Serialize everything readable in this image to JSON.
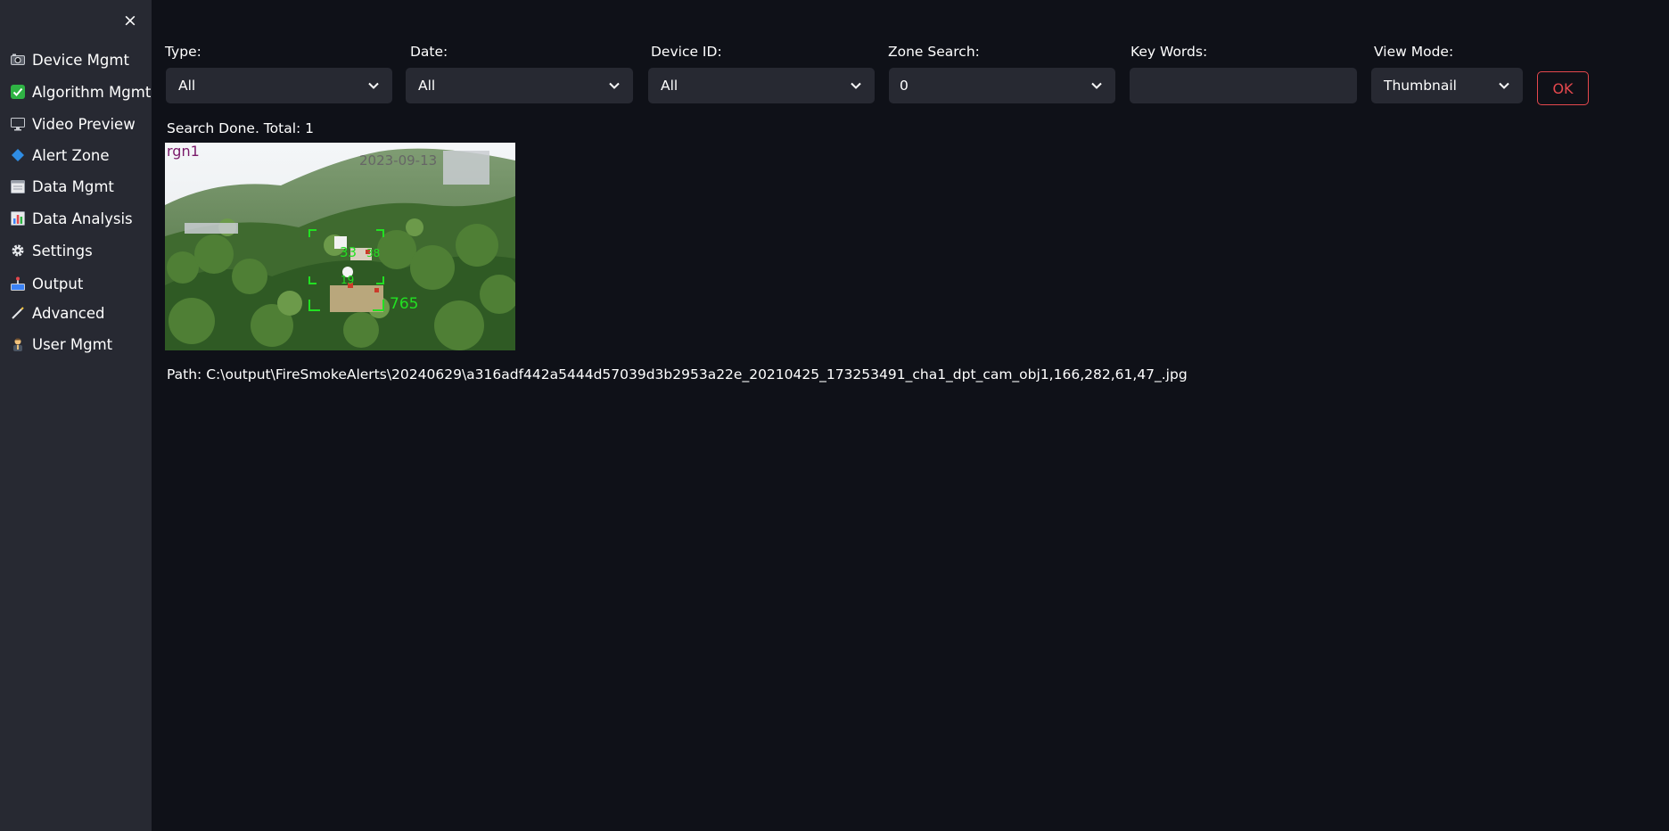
{
  "sidebar": {
    "close_icon": "×",
    "items": [
      {
        "label": "Device Mgmt",
        "icon": "camera-icon"
      },
      {
        "label": "Algorithm Mgmt",
        "icon": "check-icon"
      },
      {
        "label": "Video Preview",
        "icon": "monitor-icon"
      },
      {
        "label": "Alert Zone",
        "icon": "diamond-icon"
      },
      {
        "label": "Data Mgmt",
        "icon": "calendar-icon"
      },
      {
        "label": "Data Analysis",
        "icon": "bar-chart-icon"
      },
      {
        "label": "Settings",
        "icon": "gear-icon"
      },
      {
        "label": "Output",
        "icon": "output-icon"
      },
      {
        "label": "Advanced",
        "icon": "wand-icon"
      },
      {
        "label": "User Mgmt",
        "icon": "user-icon"
      }
    ]
  },
  "filters": {
    "type": {
      "label": "Type:",
      "value": "All"
    },
    "date": {
      "label": "Date:",
      "value": "All"
    },
    "device_id": {
      "label": "Device ID:",
      "value": "All"
    },
    "zone_search": {
      "label": "Zone Search:",
      "value": "0"
    },
    "key_words": {
      "label": "Key Words:",
      "value": "",
      "placeholder": ""
    },
    "view_mode": {
      "label": "View Mode:",
      "value": "Thumbnail"
    },
    "ok_label": "OK"
  },
  "results": {
    "status": "Search Done. Total: 1",
    "thumbnail": {
      "region_label": "rgn1",
      "timestamp": "2023-09-13",
      "box_label_1": "33",
      "box_label_2": "38",
      "box_label_3": "19",
      "box_label_4": "765"
    },
    "path": "Path: C:\\output\\FireSmokeAlerts\\20240629\\a316adf442a5444d57039d3b2953a22e_20210425_173253491_cha1_dpt_cam_obj1,166,282,61,47_.jpg"
  },
  "colors": {
    "sidebar_bg": "#272932",
    "main_bg": "#0f1118",
    "control_bg": "#272932",
    "accent_red": "#e5484d",
    "detection_green": "#22e022",
    "region_label": "#7a1a6a"
  }
}
